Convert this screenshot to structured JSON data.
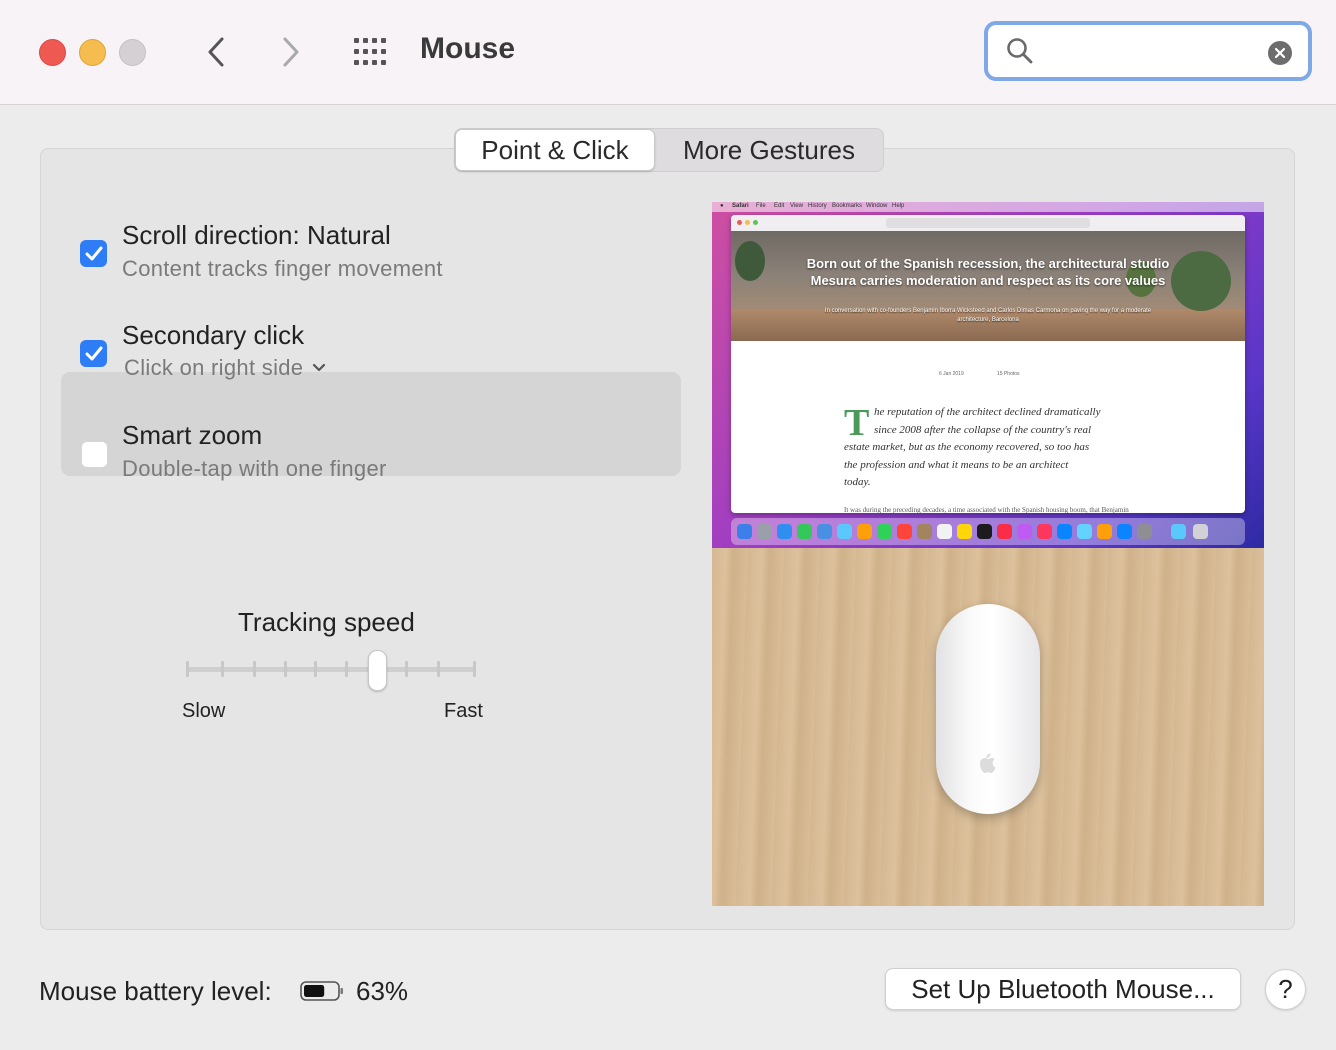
{
  "window": {
    "title": "Mouse",
    "search": {
      "value": "",
      "placeholder": ""
    }
  },
  "tabs": [
    {
      "label": "Point & Click",
      "selected": true
    },
    {
      "label": "More Gestures",
      "selected": false
    }
  ],
  "options": [
    {
      "title": "Scroll direction: Natural",
      "subtitle": "Content tracks finger movement",
      "checked": true
    },
    {
      "title": "Secondary click",
      "subtitle": "Click on right side",
      "checked": true,
      "has_dropdown": true
    },
    {
      "title": "Smart zoom",
      "subtitle": "Double-tap with one finger",
      "checked": false,
      "highlighted": true
    }
  ],
  "tracking_speed": {
    "title": "Tracking speed",
    "min_label": "Slow",
    "max_label": "Fast",
    "tick_count": 10,
    "selected_tick": 6
  },
  "preview": {
    "article_headline": "Born out of the Spanish recession, the architectural studio Mesura carries moderation and respect as its core values",
    "article_byline": "In conversation with co-founders Benjamin Iborra Wicksteed and Carlos Dimas Carmona on paving the way for a moderate architecture, Barcelona",
    "date": "6 Jan 2019",
    "photos": "15 Photos",
    "drop_cap": "T",
    "body_lines": [
      "he reputation of the architect declined dramatically",
      "since 2008 after the collapse of the country's real",
      "estate market, but as the economy recovered, so too has",
      "the profession and what it means to be an architect",
      "today."
    ],
    "body_tail": "It was during the preceding decades, a time associated with the Spanish housing boom, that Benjamin Iborra Wicksteed and Carlos Dimas Carmona, co-founders of Mesura,"
  },
  "footer": {
    "battery_label": "Mouse battery level:",
    "battery_value": "63%",
    "battery_fraction": 0.63,
    "setup_button": "Set Up Bluetooth Mouse...",
    "help_button": "?"
  },
  "colors": {
    "accent": "#2f7df6",
    "close": "#ee5a52",
    "minimize": "#f5bd4f",
    "zoom": "#d4d0d4",
    "search_focus": "#7fa8e6"
  }
}
